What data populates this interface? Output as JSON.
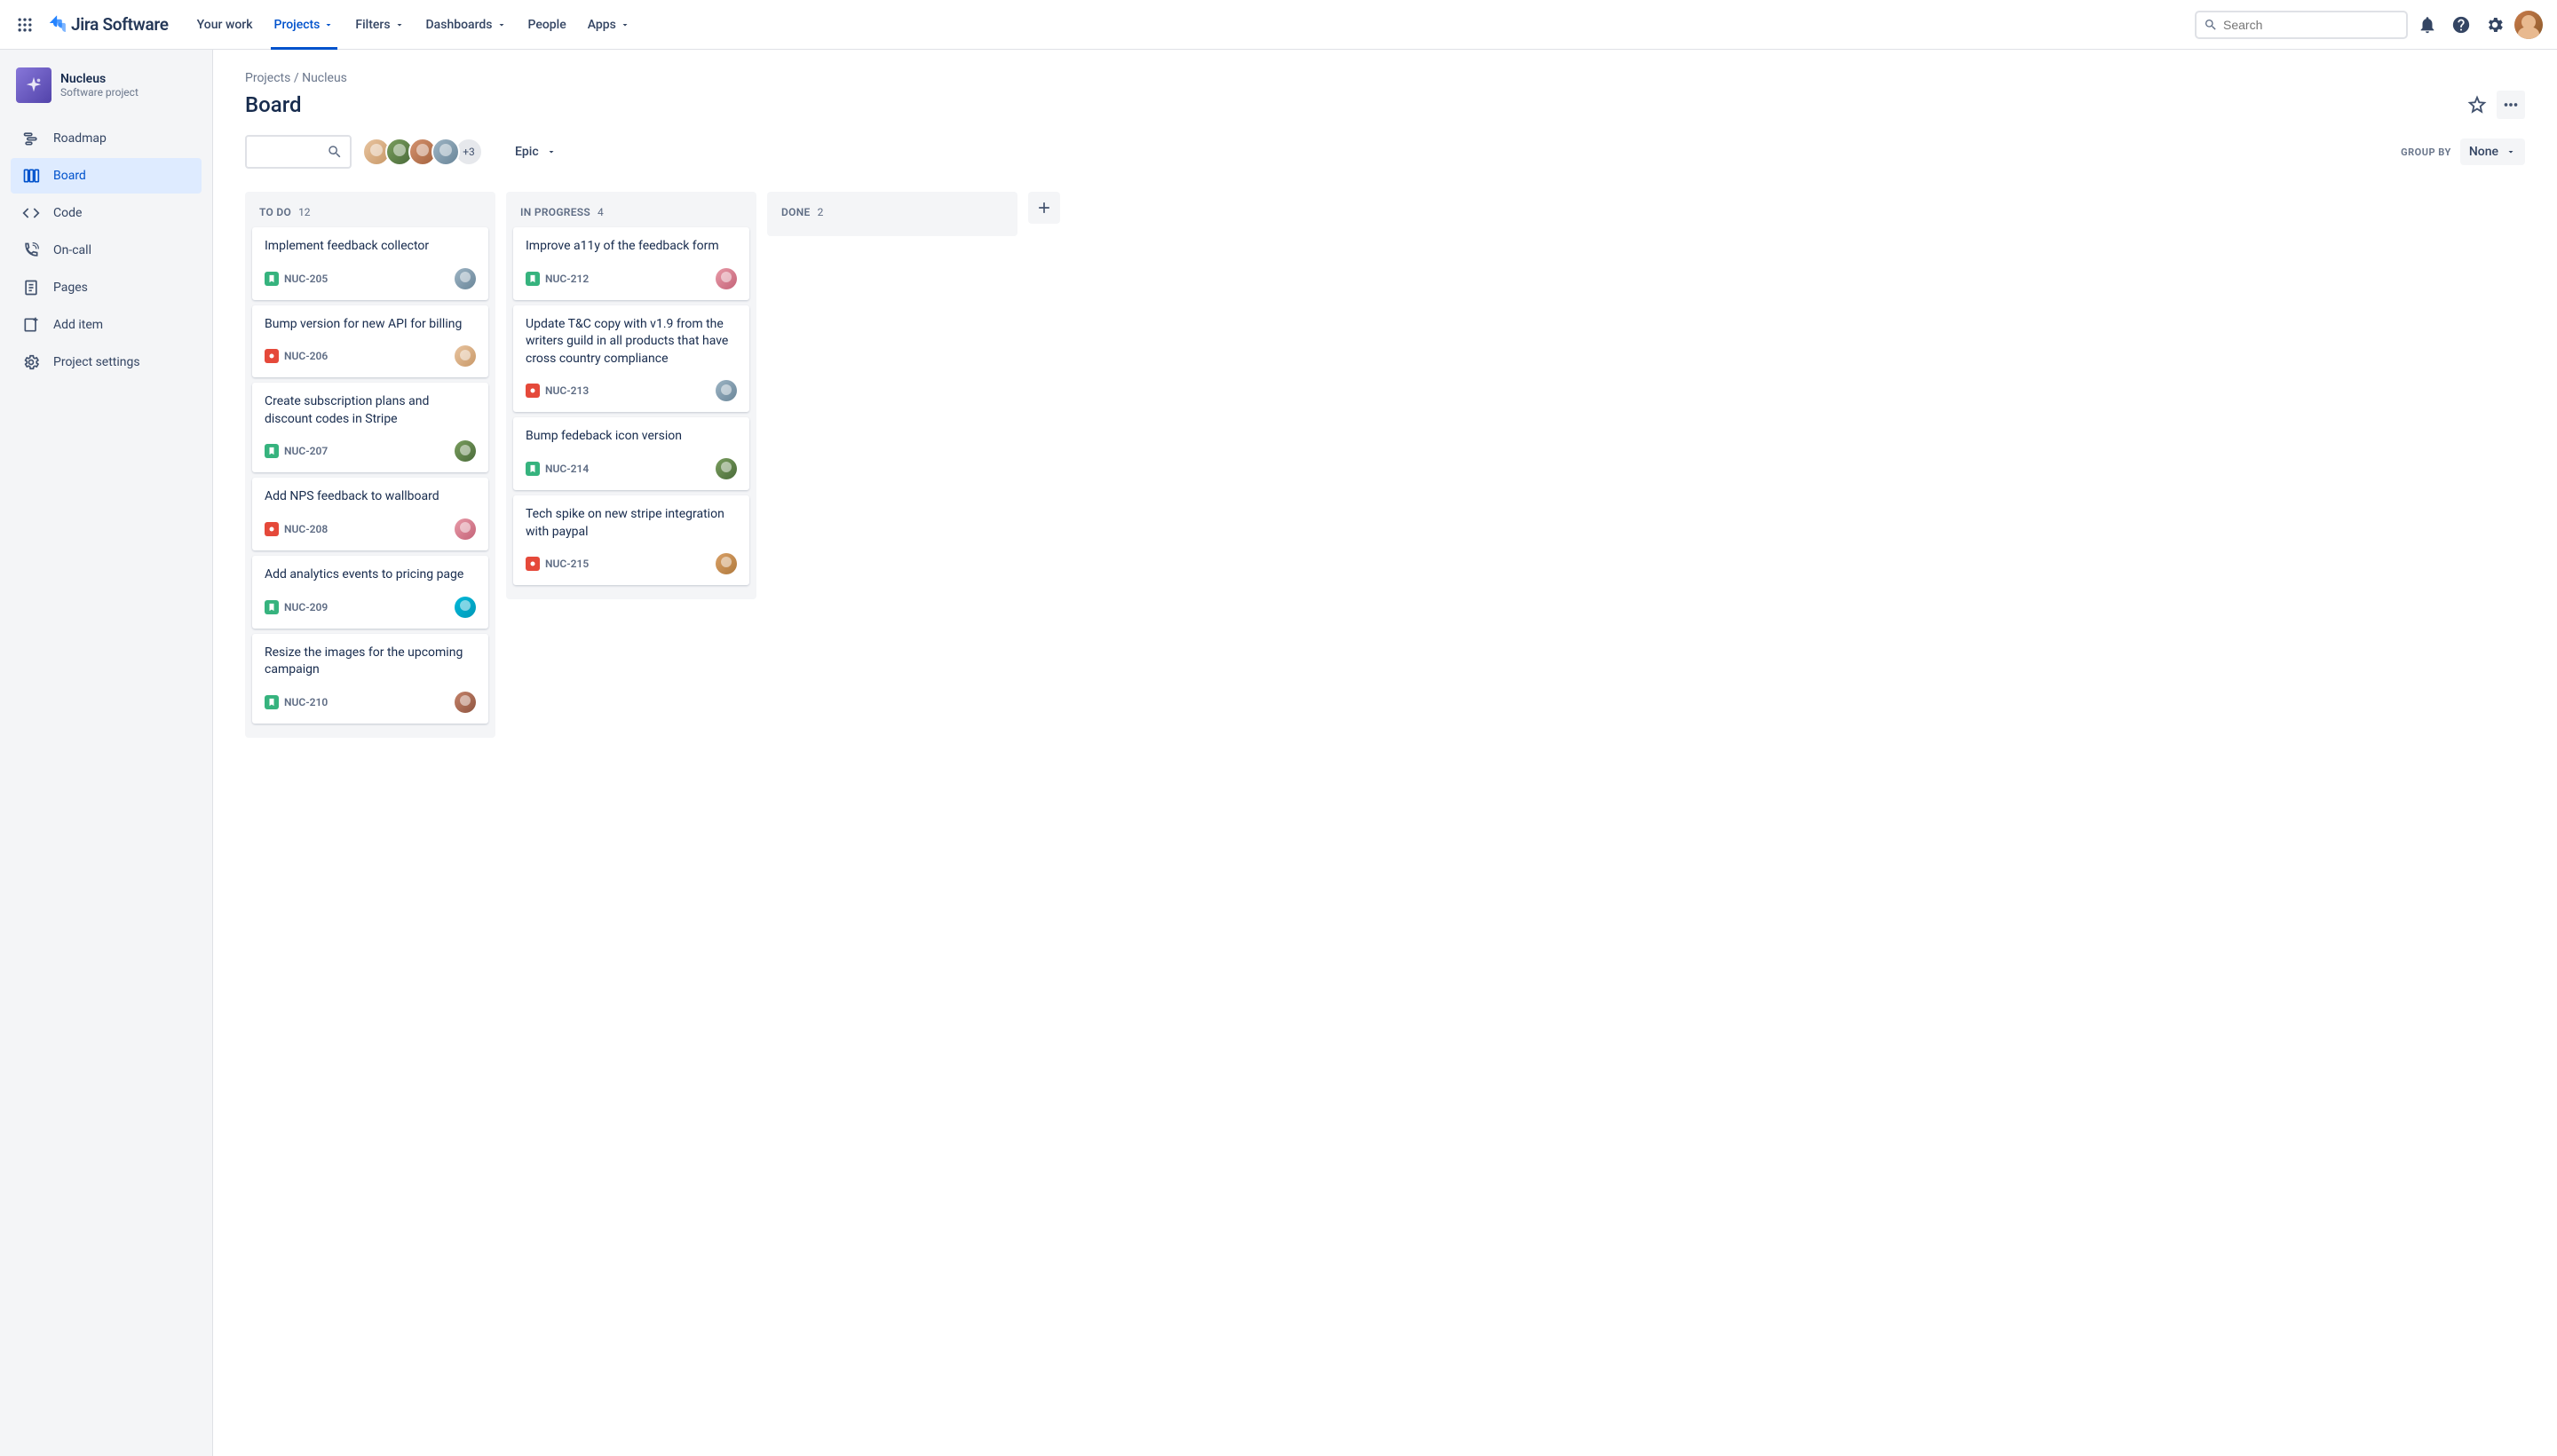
{
  "logo_text": "Jira Software",
  "nav": {
    "your_work": "Your work",
    "projects": "Projects",
    "filters": "Filters",
    "dashboards": "Dashboards",
    "people": "People",
    "apps": "Apps"
  },
  "search_placeholder": "Search",
  "sidebar": {
    "project_name": "Nucleus",
    "project_subtitle": "Software project",
    "items": {
      "roadmap": "Roadmap",
      "board": "Board",
      "code": "Code",
      "oncall": "On-call",
      "pages": "Pages",
      "add_item": "Add item",
      "settings": "Project settings"
    }
  },
  "breadcrumb": {
    "projects": "Projects",
    "sep": " / ",
    "current": "Nucleus"
  },
  "page_title": "Board",
  "avatar_more": "+3",
  "epic_label": "Epic",
  "group_by_label": "GROUP BY",
  "group_by_value": "None",
  "columns": {
    "todo": {
      "title": "TO DO",
      "count": "12"
    },
    "inprogress": {
      "title": "IN PROGRESS",
      "count": "4"
    },
    "done": {
      "title": "DONE",
      "count": "2"
    }
  },
  "cards": {
    "todo": [
      {
        "title": "Implement feedback collector",
        "key": "NUC-205",
        "type": "story",
        "assignee": "c4"
      },
      {
        "title": "Bump version for new API for billing",
        "key": "NUC-206",
        "type": "bug",
        "assignee": "c1"
      },
      {
        "title": "Create subscription plans and discount codes in Stripe",
        "key": "NUC-207",
        "type": "story",
        "assignee": "c2"
      },
      {
        "title": "Add NPS feedback to wallboard",
        "key": "NUC-208",
        "type": "bug",
        "assignee": "c5"
      },
      {
        "title": "Add analytics events to pricing page",
        "key": "NUC-209",
        "type": "story",
        "assignee": "c6"
      },
      {
        "title": "Resize the images for the upcoming campaign",
        "key": "NUC-210",
        "type": "story",
        "assignee": "c7"
      }
    ],
    "inprogress": [
      {
        "title": "Improve a11y of the feedback form",
        "key": "NUC-212",
        "type": "story",
        "assignee": "c5"
      },
      {
        "title": "Update T&C copy with v1.9 from the writers guild in all products that have cross country compliance",
        "key": "NUC-213",
        "type": "bug",
        "assignee": "c4"
      },
      {
        "title": "Bump fedeback icon version",
        "key": "NUC-214",
        "type": "story",
        "assignee": "c2"
      },
      {
        "title": "Tech spike on new stripe integration with paypal",
        "key": "NUC-215",
        "type": "bug",
        "assignee": "c8"
      }
    ],
    "done": []
  }
}
